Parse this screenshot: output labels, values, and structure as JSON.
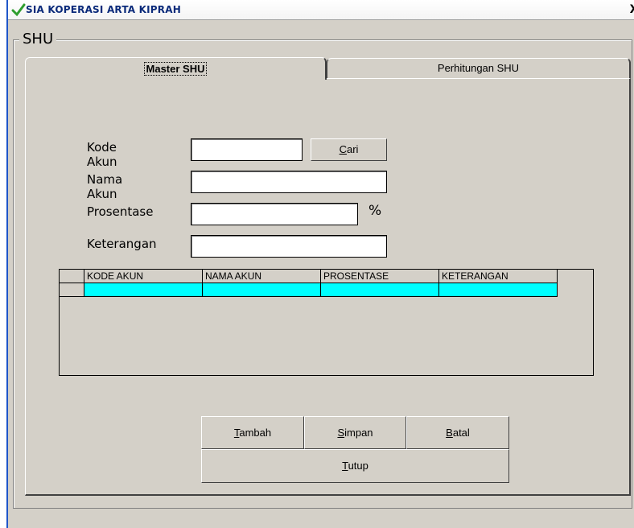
{
  "window": {
    "title": "SIA KOPERASI ARTA KIPRAH",
    "close_glyph": "X",
    "icon": "checkmark-icon"
  },
  "group": {
    "legend": "SHU"
  },
  "tabs": [
    {
      "label": "Master SHU",
      "active": true
    },
    {
      "label": "Perhitungan SHU",
      "active": false
    }
  ],
  "form": {
    "kode_akun_label": "Kode Akun",
    "kode_akun_value": "",
    "cari_button": {
      "hotkey": "C",
      "rest": "ari"
    },
    "nama_akun_label": "Nama Akun",
    "nama_akun_value": "",
    "prosentase_label": "Prosentase",
    "prosentase_value": "",
    "percent_sign": "%",
    "keterangan_label": "Keterangan",
    "keterangan_value": ""
  },
  "grid": {
    "columns": [
      "KODE AKUN",
      "NAMA AKUN",
      "PROSENTASE",
      "KETERANGAN"
    ],
    "selected_row_color": "#00ffff"
  },
  "buttons": {
    "tambah": {
      "hotkey": "T",
      "rest": "ambah"
    },
    "simpan": {
      "hotkey": "S",
      "rest": "impan"
    },
    "batal": {
      "hotkey": "B",
      "rest": "atal"
    },
    "tutup": {
      "hotkey": "T",
      "rest": "utup"
    }
  }
}
